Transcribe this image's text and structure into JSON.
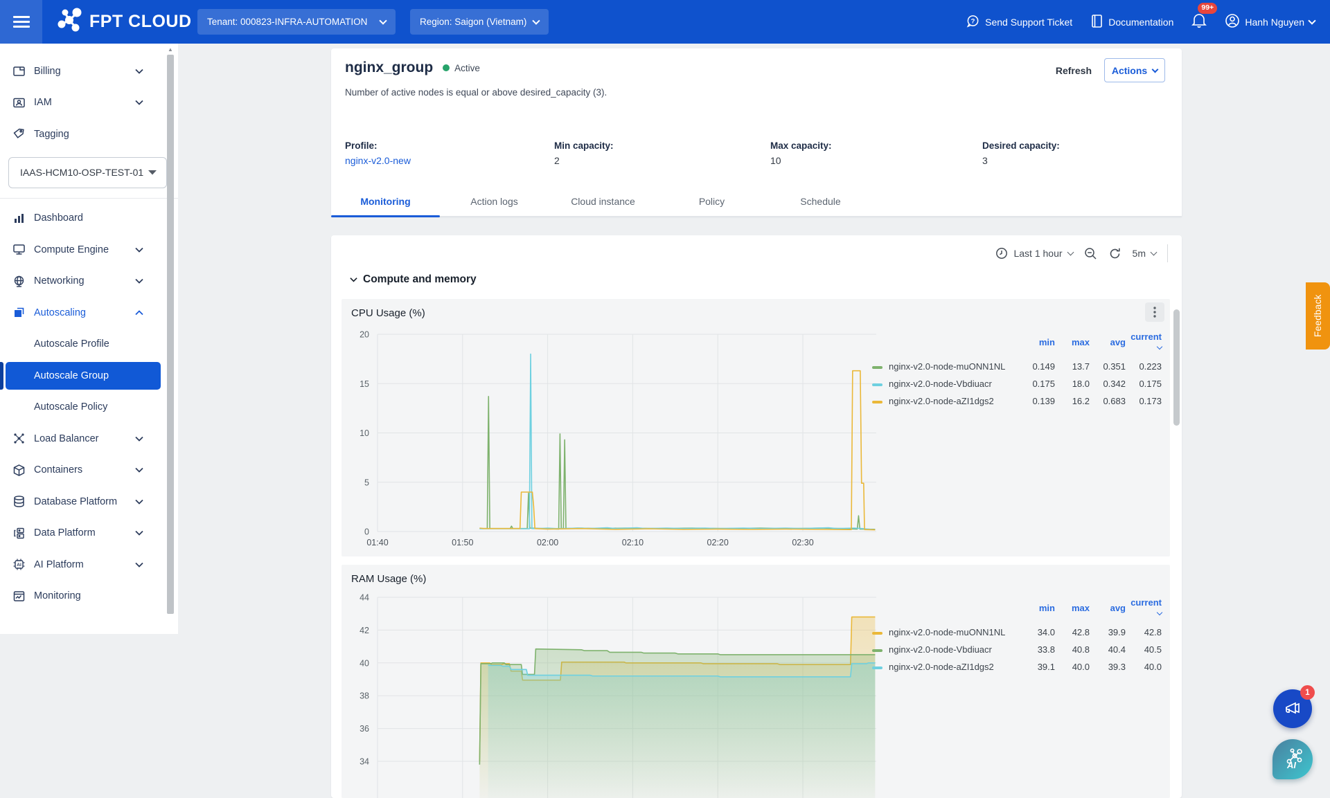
{
  "topbar": {
    "brand": "FPT CLOUD",
    "tenant": "Tenant: 000823-INFRA-AUTOMATION",
    "region": "Region: Saigon (Vietnam)",
    "support": "Send Support Ticket",
    "documentation": "Documentation",
    "notification_badge": "99+",
    "user_name": "Hanh Nguyen"
  },
  "sidebar": {
    "vpc_select": "IAAS-HCM10-OSP-TEST-01",
    "items": [
      {
        "label": "Billing"
      },
      {
        "label": "IAM"
      },
      {
        "label": "Tagging"
      },
      {
        "label": "Dashboard"
      },
      {
        "label": "Compute Engine"
      },
      {
        "label": "Networking"
      },
      {
        "label": "Autoscaling"
      },
      {
        "label": "Autoscale Profile"
      },
      {
        "label": "Autoscale Group"
      },
      {
        "label": "Autoscale Policy"
      },
      {
        "label": "Load Balancer"
      },
      {
        "label": "Containers"
      },
      {
        "label": "Database Platform"
      },
      {
        "label": "Data Platform"
      },
      {
        "label": "AI Platform"
      },
      {
        "label": "Monitoring"
      }
    ]
  },
  "page": {
    "header": {
      "title": "nginx_group",
      "status": "Active",
      "subtitle": "Number of active nodes is equal or above desired_capacity (3).",
      "refresh": "Refresh",
      "actions": "Actions"
    },
    "stats": {
      "profile_label": "Profile:",
      "profile_value": "nginx-v2.0-new",
      "min_label": "Min capacity:",
      "min_value": "2",
      "max_label": "Max capacity:",
      "max_value": "10",
      "desired_label": "Desired capacity:",
      "desired_value": "3"
    },
    "tabs": [
      "Monitoring",
      "Action logs",
      "Cloud instance",
      "Policy",
      "Schedule"
    ]
  },
  "monitoring": {
    "time_range": "Last 1 hour",
    "interval": "5m",
    "section_title": "Compute and memory"
  },
  "floating": {
    "feedback": "Feedback",
    "megaphone_badge": "1"
  },
  "chart_data": [
    {
      "type": "line",
      "title": "CPU Usage (%)",
      "ylim": [
        0,
        20
      ],
      "yticks": [
        0,
        5,
        10,
        15,
        20
      ],
      "xticks": [
        {
          "m": 0,
          "label": "01:40"
        },
        {
          "m": 10,
          "label": "01:50"
        },
        {
          "m": 20,
          "label": "02:00"
        },
        {
          "m": 30,
          "label": "02:10"
        },
        {
          "m": 40,
          "label": "02:20"
        },
        {
          "m": 50,
          "label": "02:30"
        }
      ],
      "show_xlabels": true,
      "legend_columns": [
        "min",
        "max",
        "avg",
        "current"
      ],
      "series": [
        {
          "name": "nginx-v2.0-node-muONN1NL",
          "color": "#7EB26D",
          "stats": {
            "min": "0.149",
            "max": "13.7",
            "avg": "0.351",
            "current": "0.223"
          },
          "points": [
            [
              12,
              0.3
            ],
            [
              12.9,
              0.3
            ],
            [
              13.05,
              13.7
            ],
            [
              13.2,
              0.3
            ],
            [
              15.6,
              0.3
            ],
            [
              15.75,
              0.55
            ],
            [
              15.9,
              0.3
            ],
            [
              17.6,
              0.3
            ],
            [
              17.75,
              3.9
            ],
            [
              17.9,
              0.35
            ],
            [
              21.3,
              0.25
            ],
            [
              21.45,
              9.9
            ],
            [
              21.6,
              0.3
            ],
            [
              21.85,
              0.3
            ],
            [
              22.0,
              9.3
            ],
            [
              22.15,
              0.3
            ],
            [
              23.5,
              0.35
            ],
            [
              26,
              0.3
            ],
            [
              29,
              0.35
            ],
            [
              33,
              0.3
            ],
            [
              37,
              0.35
            ],
            [
              41,
              0.3
            ],
            [
              45,
              0.35
            ],
            [
              49,
              0.3
            ],
            [
              52,
              0.35
            ],
            [
              54.5,
              0.3
            ],
            [
              56.4,
              0.25
            ],
            [
              56.55,
              1.6
            ],
            [
              56.7,
              0.25
            ],
            [
              58.5,
              0.223
            ]
          ]
        },
        {
          "name": "nginx-v2.0-node-Vbdiuacr",
          "color": "#6ED0E0",
          "stats": {
            "min": "0.175",
            "max": "18.0",
            "avg": "0.342",
            "current": "0.175"
          },
          "points": [
            [
              12,
              0.28
            ],
            [
              17.85,
              0.28
            ],
            [
              18.0,
              18.0
            ],
            [
              18.15,
              0.3
            ],
            [
              19,
              0.3
            ],
            [
              20,
              0.35
            ],
            [
              21,
              0.3
            ],
            [
              24,
              0.35
            ],
            [
              24.8,
              0.3
            ],
            [
              27,
              0.38
            ],
            [
              28,
              0.3
            ],
            [
              30.5,
              0.38
            ],
            [
              31.5,
              0.3
            ],
            [
              34,
              0.35
            ],
            [
              36,
              0.3
            ],
            [
              38.5,
              0.35
            ],
            [
              40,
              0.3
            ],
            [
              43,
              0.35
            ],
            [
              45,
              0.3
            ],
            [
              48,
              0.35
            ],
            [
              50,
              0.3
            ],
            [
              53,
              0.38
            ],
            [
              54,
              0.3
            ],
            [
              56,
              0.35
            ],
            [
              57,
              0.3
            ],
            [
              58.5,
              0.175
            ]
          ]
        },
        {
          "name": "nginx-v2.0-node-aZI1dgs2",
          "color": "#EAB839",
          "stats": {
            "min": "0.139",
            "max": "16.2",
            "avg": "0.683",
            "current": "0.173"
          },
          "points": [
            [
              12,
              0.35
            ],
            [
              12.5,
              0.3
            ],
            [
              16.75,
              0.3
            ],
            [
              16.9,
              4.0
            ],
            [
              18.2,
              4.0
            ],
            [
              18.35,
              2.6
            ],
            [
              18.5,
              0.3
            ],
            [
              20,
              0.25
            ],
            [
              24,
              0.3
            ],
            [
              28,
              0.22
            ],
            [
              32,
              0.28
            ],
            [
              36,
              0.22
            ],
            [
              40,
              0.25
            ],
            [
              44,
              0.22
            ],
            [
              48,
              0.25
            ],
            [
              52,
              0.22
            ],
            [
              55.7,
              0.2
            ],
            [
              55.85,
              16.3
            ],
            [
              56.75,
              16.3
            ],
            [
              56.9,
              4.9
            ],
            [
              57.15,
              4.9
            ],
            [
              57.25,
              0.2
            ],
            [
              58.5,
              0.173
            ]
          ]
        }
      ]
    },
    {
      "type": "area",
      "title": "RAM Usage (%)",
      "ylim": [
        34,
        44
      ],
      "yticks": [
        44,
        42,
        40,
        38,
        36,
        34
      ],
      "xticks": [
        {
          "m": 0,
          "label": "01:40"
        },
        {
          "m": 10,
          "label": "01:50"
        },
        {
          "m": 20,
          "label": "02:00"
        },
        {
          "m": 30,
          "label": "02:10"
        },
        {
          "m": 40,
          "label": "02:20"
        },
        {
          "m": 50,
          "label": "02:30"
        }
      ],
      "show_xlabels": false,
      "legend_columns": [
        "min",
        "max",
        "avg",
        "current"
      ],
      "series": [
        {
          "name": "nginx-v2.0-node-muONN1NL",
          "color": "#EAB839",
          "stats": {
            "min": "34.0",
            "max": "42.8",
            "avg": "39.9",
            "current": "42.8"
          },
          "points": [
            [
              12,
              34.0
            ],
            [
              12.15,
              40.0
            ],
            [
              13.2,
              40.0
            ],
            [
              13.4,
              39.9
            ],
            [
              14.6,
              39.9
            ],
            [
              14.8,
              39.95
            ],
            [
              15.5,
              39.95
            ],
            [
              15.7,
              39.5
            ],
            [
              16.9,
              39.5
            ],
            [
              17.05,
              38.95
            ],
            [
              21.5,
              38.95
            ],
            [
              21.65,
              40.05
            ],
            [
              29,
              40.05
            ],
            [
              29.2,
              40.0
            ],
            [
              38,
              40.0
            ],
            [
              38.3,
              39.95
            ],
            [
              47,
              39.95
            ],
            [
              47.3,
              39.9
            ],
            [
              55.6,
              39.9
            ],
            [
              55.75,
              42.8
            ],
            [
              58.5,
              42.8
            ]
          ]
        },
        {
          "name": "nginx-v2.0-node-Vbdiuacr",
          "color": "#7EB26D",
          "stats": {
            "min": "33.8",
            "max": "40.8",
            "avg": "40.4",
            "current": "40.5"
          },
          "points": [
            [
              12,
              33.8
            ],
            [
              12.15,
              39.95
            ],
            [
              13.3,
              39.95
            ],
            [
              13.5,
              40.0
            ],
            [
              14.9,
              40.0
            ],
            [
              15.1,
              39.9
            ],
            [
              16.9,
              39.9
            ],
            [
              17.05,
              39.3
            ],
            [
              18.45,
              39.3
            ],
            [
              18.6,
              40.85
            ],
            [
              24,
              40.8
            ],
            [
              24.3,
              40.75
            ],
            [
              27,
              40.75
            ],
            [
              27.3,
              40.65
            ],
            [
              31,
              40.65
            ],
            [
              31.3,
              40.6
            ],
            [
              35,
              40.6
            ],
            [
              35.3,
              40.55
            ],
            [
              40,
              40.55
            ],
            [
              40.3,
              40.5
            ],
            [
              58.5,
              40.5
            ]
          ]
        },
        {
          "name": "nginx-v2.0-node-aZI1dgs2",
          "color": "#6ED0E0",
          "stats": {
            "min": "39.1",
            "max": "40.0",
            "avg": "39.3",
            "current": "40.0"
          },
          "points": [
            [
              13,
              39.85
            ],
            [
              14.5,
              39.85
            ],
            [
              14.7,
              39.8
            ],
            [
              15.5,
              39.8
            ],
            [
              15.7,
              39.6
            ],
            [
              17.5,
              39.6
            ],
            [
              17.65,
              39.25
            ],
            [
              25,
              39.25
            ],
            [
              25.3,
              39.2
            ],
            [
              40,
              39.2
            ],
            [
              40.3,
              39.15
            ],
            [
              55.6,
              39.15
            ],
            [
              55.75,
              39.95
            ],
            [
              57.5,
              39.95
            ],
            [
              57.7,
              40.0
            ],
            [
              58.5,
              40.0
            ]
          ]
        }
      ]
    }
  ]
}
